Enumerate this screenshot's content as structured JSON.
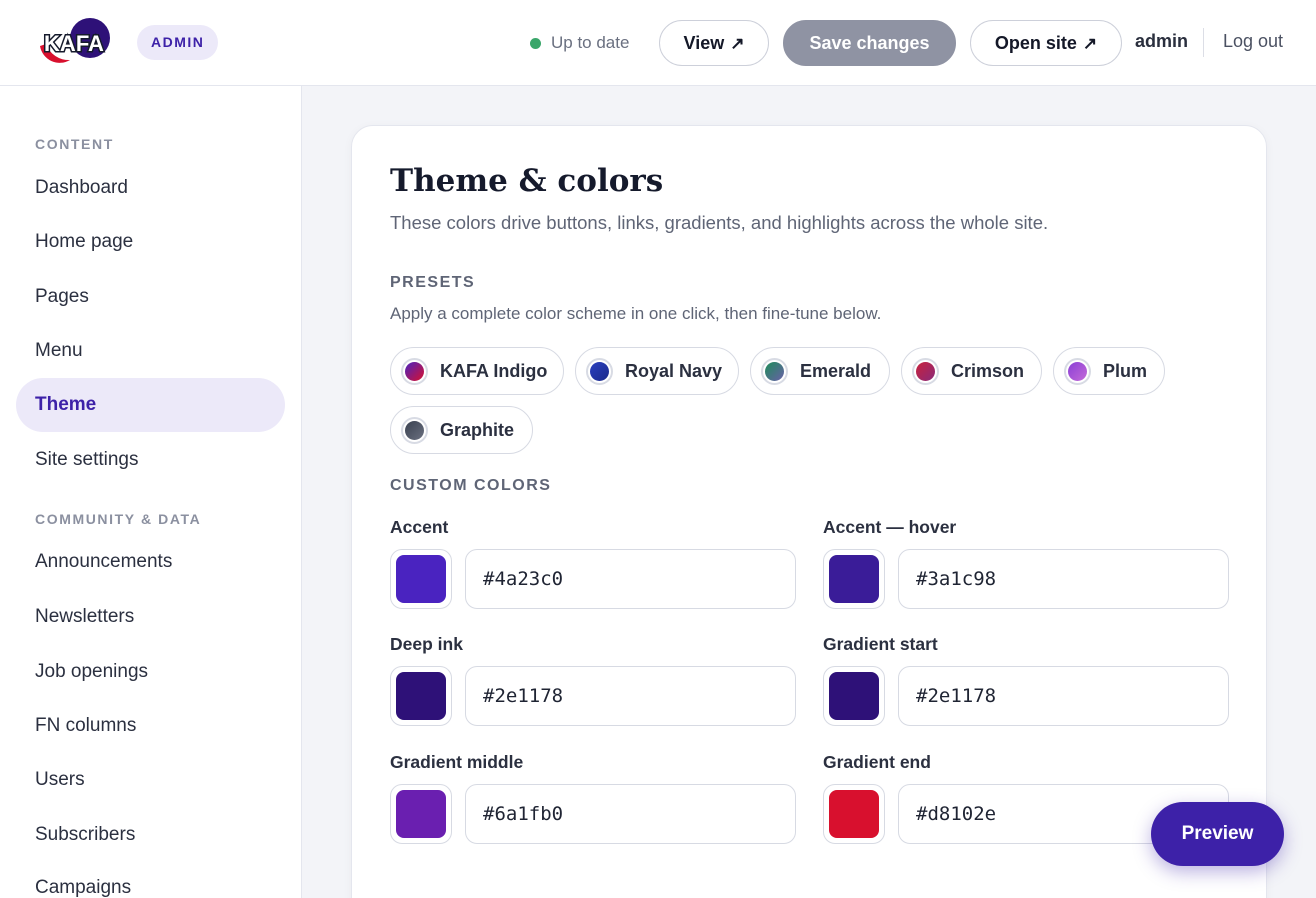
{
  "header": {
    "brand_text": "KAFA",
    "badge": "ADMIN",
    "status_text": "Up to date",
    "status_color": "#3aa66a",
    "view_label": "View",
    "save_label": "Save changes",
    "open_site_label": "Open site",
    "user_name": "admin",
    "logout_label": "Log out"
  },
  "sidebar": {
    "content_heading": "CONTENT",
    "content_items": [
      "Dashboard",
      "Home page",
      "Pages",
      "Menu",
      "Theme",
      "Site settings"
    ],
    "active_item": "Theme",
    "community_heading": "COMMUNITY & DATA",
    "community_items": [
      "Announcements",
      "Newsletters",
      "Job openings",
      "FN columns",
      "Users",
      "Subscribers",
      "Campaigns"
    ]
  },
  "card": {
    "title": "Theme & colors",
    "subtitle": "These colors drive buttons, links, gradients, and highlights across the whole site.",
    "presets_heading": "PRESETS",
    "presets_help": "Apply a complete color scheme in one click, then fine-tune below.",
    "presets": [
      {
        "label": "KAFA Indigo",
        "color_a": "#4a23c0",
        "color_b": "#d8102e"
      },
      {
        "label": "Royal Navy",
        "color_a": "#2a3fbf",
        "color_b": "#1b2a8a"
      },
      {
        "label": "Emerald",
        "color_a": "#1e8c5a",
        "color_b": "#6a5fa8"
      },
      {
        "label": "Crimson",
        "color_a": "#c8213c",
        "color_b": "#8a2a7a"
      },
      {
        "label": "Plum",
        "color_a": "#8a3fd6",
        "color_b": "#c46ad8"
      },
      {
        "label": "Graphite",
        "color_a": "#3a4150",
        "color_b": "#6a7080"
      }
    ],
    "custom_heading": "CUSTOM COLORS",
    "fields": [
      {
        "label": "Accent",
        "value": "#4a23c0"
      },
      {
        "label": "Accent — hover",
        "value": "#3a1c98"
      },
      {
        "label": "Deep ink",
        "value": "#2e1178"
      },
      {
        "label": "Gradient start",
        "value": "#2e1178"
      },
      {
        "label": "Gradient middle",
        "value": "#6a1fb0"
      },
      {
        "label": "Gradient end",
        "value": "#d8102e"
      }
    ]
  },
  "preview_label": "Preview"
}
